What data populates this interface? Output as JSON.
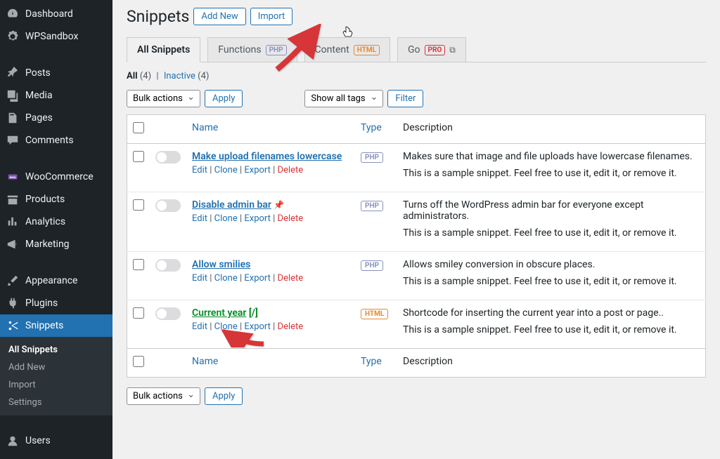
{
  "sidebar": {
    "items": [
      {
        "label": "Dashboard",
        "icon": "dashboard"
      },
      {
        "label": "WPSandbox",
        "icon": "gear"
      },
      {
        "label": "Posts",
        "icon": "pin",
        "sep": true
      },
      {
        "label": "Media",
        "icon": "media"
      },
      {
        "label": "Pages",
        "icon": "pages"
      },
      {
        "label": "Comments",
        "icon": "comment"
      },
      {
        "label": "WooCommerce",
        "icon": "woo",
        "sep": true
      },
      {
        "label": "Products",
        "icon": "products"
      },
      {
        "label": "Analytics",
        "icon": "analytics"
      },
      {
        "label": "Marketing",
        "icon": "marketing"
      },
      {
        "label": "Appearance",
        "icon": "brush",
        "sep": true
      },
      {
        "label": "Plugins",
        "icon": "plug"
      },
      {
        "label": "Snippets",
        "icon": "scissors",
        "active": true
      },
      {
        "label": "Users",
        "icon": "user",
        "sep": true
      }
    ],
    "submenu": [
      {
        "label": "All Snippets",
        "active": true
      },
      {
        "label": "Add New"
      },
      {
        "label": "Import"
      },
      {
        "label": "Settings"
      }
    ]
  },
  "heading": {
    "title": "Snippets",
    "add_new": "Add New",
    "import": "Import"
  },
  "tabs": [
    {
      "label": "All Snippets",
      "active": true
    },
    {
      "label": "Functions",
      "badge": "PHP"
    },
    {
      "label": "Content",
      "badge": "HTML"
    },
    {
      "label": "Go",
      "badge": "PRO",
      "ext": true
    }
  ],
  "subsubsub": {
    "all": "All",
    "all_count": "(4)",
    "inactive": "Inactive",
    "inactive_count": "(4)",
    "sep": "|"
  },
  "controls": {
    "bulk": "Bulk actions",
    "apply": "Apply",
    "tags": "Show all tags",
    "filter": "Filter"
  },
  "columns": {
    "name": "Name",
    "type": "Type",
    "description": "Description"
  },
  "rows": [
    {
      "title": "Make upload filenames lowercase",
      "type": "PHP",
      "type_class": "php",
      "desc1": "Makes sure that image and file uploads have lowercase filenames.",
      "desc2": "This is a sample snippet. Feel free to use it, edit it, or remove it."
    },
    {
      "title": "Disable admin bar",
      "pin": true,
      "type": "PHP",
      "type_class": "php",
      "desc1": "Turns off the WordPress admin bar for everyone except administrators.",
      "desc2": "This is a sample snippet. Feel free to use it, edit it, or remove it."
    },
    {
      "title": "Allow smilies",
      "type": "PHP",
      "type_class": "php",
      "desc1": "Allows smiley conversion in obscure places.",
      "desc2": "This is a sample snippet. Feel free to use it, edit it, or remove it."
    },
    {
      "title": "Current year",
      "shortcode": "[/]",
      "green": true,
      "type": "HTML",
      "type_class": "html",
      "desc1": "Shortcode for inserting the current year into a post or page..",
      "desc2": "This is a sample snippet. Feel free to use it, edit it, or remove it."
    }
  ],
  "row_actions": {
    "edit": "Edit",
    "clone": "Clone",
    "export": "Export",
    "delete": "Delete",
    "sep": " | "
  }
}
